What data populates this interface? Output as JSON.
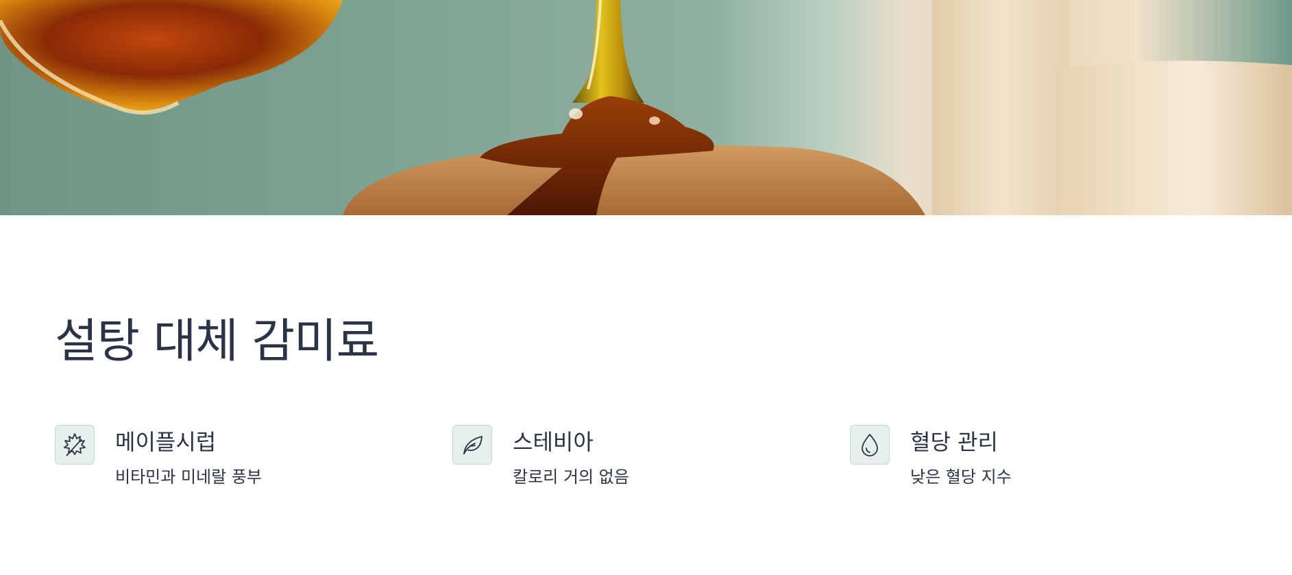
{
  "hero": {
    "image": "maple-syrup-pouring-on-pancake"
  },
  "section": {
    "title": "설탕 대체 감미료"
  },
  "features": [
    {
      "icon": "maple-leaf-icon",
      "title": "메이플시럽",
      "desc": "비타민과 미네랄 풍부"
    },
    {
      "icon": "leaf-icon",
      "title": "스테비아",
      "desc": "칼로리 거의 없음"
    },
    {
      "icon": "droplet-icon",
      "title": "혈당 관리",
      "desc": "낮은 혈당 지수"
    }
  ],
  "colors": {
    "text": "#2b3346",
    "icon_bg": "#e7efeb",
    "icon_border": "#c9d8d1",
    "hero_green": "#7ea392"
  }
}
